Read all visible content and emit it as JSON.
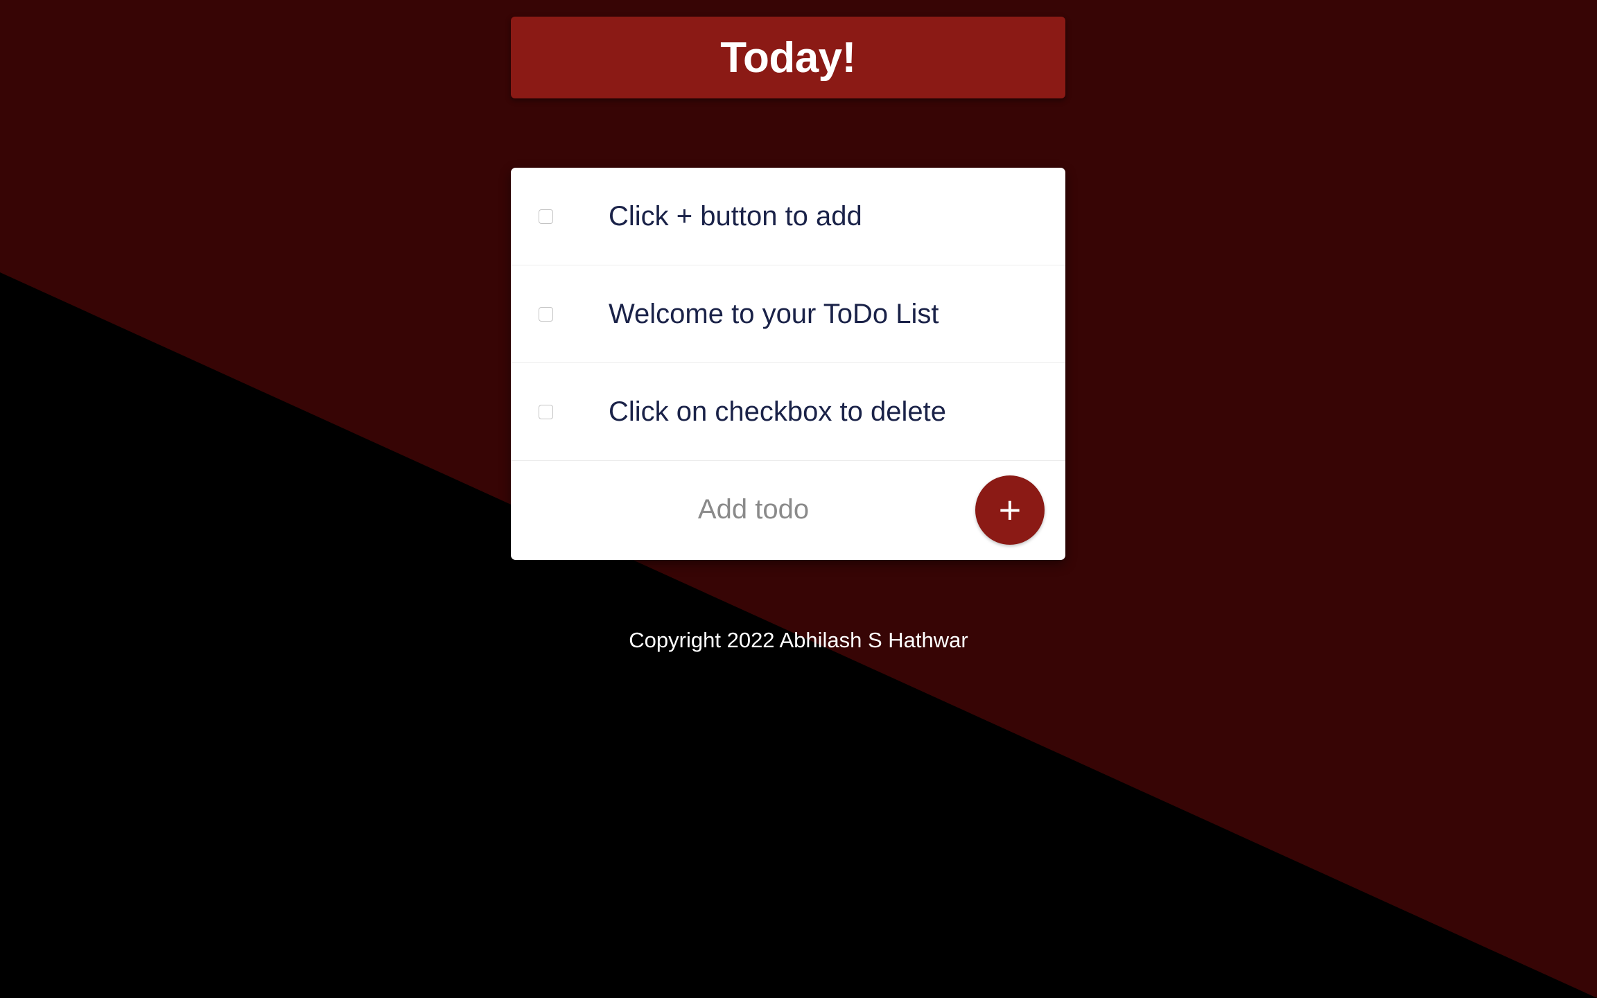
{
  "header": {
    "title": "Today!"
  },
  "todos": [
    {
      "text": "Click + button to add",
      "checked": false
    },
    {
      "text": "Welcome to your ToDo List",
      "checked": false
    },
    {
      "text": "Click on checkbox to delete",
      "checked": false
    }
  ],
  "add_form": {
    "placeholder": "Add todo",
    "value": "",
    "button_label": "+"
  },
  "footer": {
    "text": "Copyright 2022 Abhilash S Hathwar"
  },
  "colors": {
    "background_dark": "#000000",
    "background_red": "#370505",
    "accent": "#8b1a15",
    "card": "#ffffff",
    "todo_text": "#1a2248"
  }
}
